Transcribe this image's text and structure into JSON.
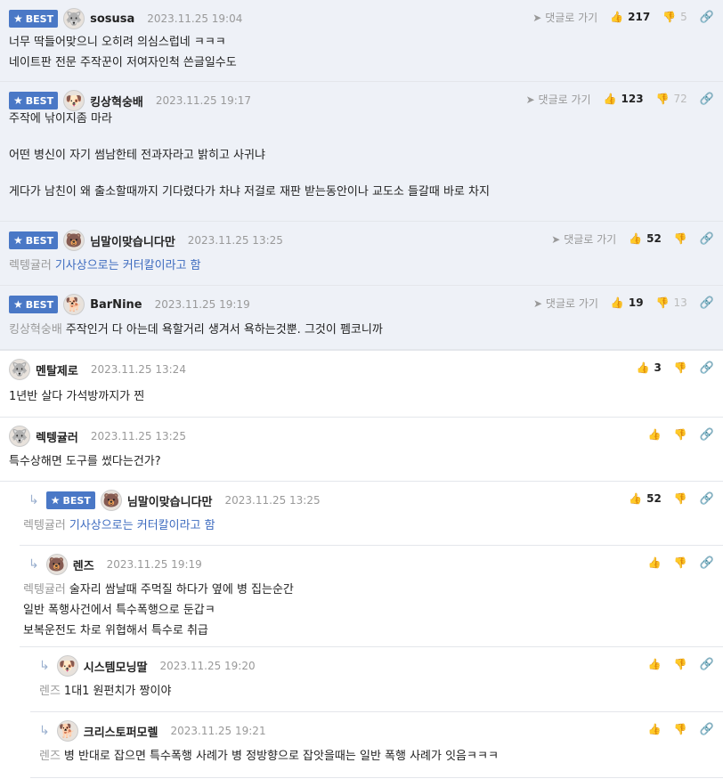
{
  "ui": {
    "best_label": "BEST",
    "reply_label": "댓글로 가기"
  },
  "comments": [
    {
      "nick": "sosusa",
      "date": "2023.11.25 19:04",
      "likes": "217",
      "dislikes": "5",
      "lines": [
        "너무 딱들어맞으니 오히려 의심스럽네 ㅋㅋㅋ",
        "네이트판 전문 주작꾼이 저여자인척 쓴글일수도"
      ]
    },
    {
      "nick": "킹상혁숭배",
      "date": "2023.11.25 19:17",
      "likes": "123",
      "dislikes": "72",
      "lines": [
        "주작에 낚이지좀 마라",
        "",
        "어떤 병신이 자기 썸남한테 전과자라고 밝히고 사귀냐",
        "",
        "게다가 남친이 왜 출소할때까지 기다렸다가 차냐 저걸로 재판 받는동안이나 교도소 들갈때 바로 차지"
      ]
    },
    {
      "nick": "님말이맞습니다만",
      "date": "2023.11.25 13:25",
      "likes": "52",
      "mention": "렉텡귤러",
      "text": "기사상으로는 커터칼이라고 함"
    },
    {
      "nick": "BarNine",
      "date": "2023.11.25 19:19",
      "likes": "19",
      "dislikes": "13",
      "mention": "킹상혁숭배",
      "text": "주작인거 다 아는데 욕할거리 생겨서 욕하는것뿐. 그것이 펨코니까"
    },
    {
      "nick": "멘탈제로",
      "date": "2023.11.25 13:24",
      "likes": "3",
      "text": "1년반 살다 가석방까지가 찐"
    },
    {
      "nick": "렉텡귤러",
      "date": "2023.11.25 13:25",
      "text": "특수상해면 도구를 썼다는건가?"
    },
    {
      "nick": "님말이맞습니다만",
      "date": "2023.11.25 13:25",
      "likes": "52",
      "mention": "렉텡귤러",
      "text": "기사상으로는 커터칼이라고 함"
    },
    {
      "nick": "렌즈",
      "date": "2023.11.25 19:19",
      "mention": "렉텡귤러",
      "text": "술자리 쌈날때 주먹질 하다가 옆에 병 집는순간",
      "lines": [
        "일반 폭행사건에서 특수폭행으로 둔갑ㅋ",
        "보복운전도 차로 위협해서 특수로 취급"
      ]
    },
    {
      "nick": "시스템모닝딸",
      "date": "2023.11.25 19:20",
      "mention": "렌즈",
      "text": "1대1 원펀치가 짱이야"
    },
    {
      "nick": "크리스토퍼모렐",
      "date": "2023.11.25 19:21",
      "mention": "렌즈",
      "text": "병 반대로 잡으면 특수폭행 사례가 병 정방향으로 잡앗을때는 일반 폭행 사례가 잇음ㅋㅋㅋ"
    }
  ]
}
